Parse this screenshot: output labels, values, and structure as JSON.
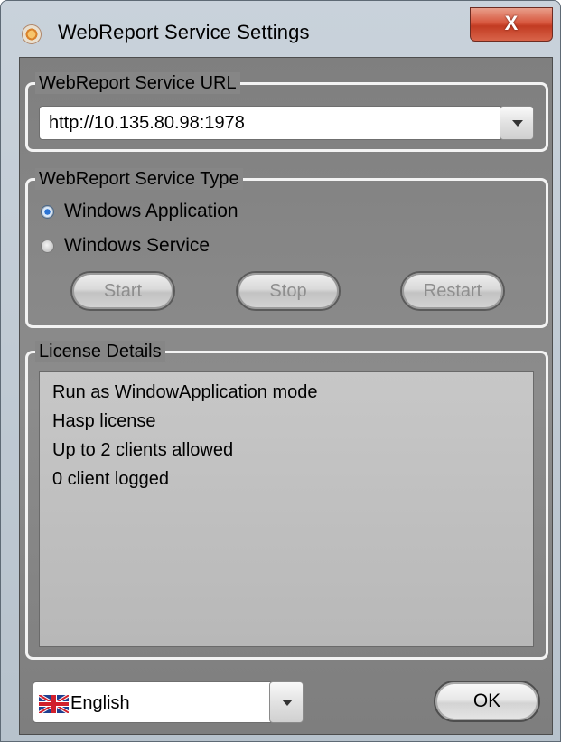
{
  "window": {
    "title": "WebReport Service Settings",
    "close_label": "X"
  },
  "url_group": {
    "legend": "WebReport Service URL",
    "selected_url": "http://10.135.80.98:1978"
  },
  "type_group": {
    "legend": "WebReport Service Type",
    "options": [
      {
        "label": "Windows Application",
        "checked": true
      },
      {
        "label": "Windows Service",
        "checked": false
      }
    ],
    "buttons": {
      "start": "Start",
      "stop": "Stop",
      "restart": "Restart"
    }
  },
  "license_group": {
    "legend": "License Details",
    "lines": [
      "Run as WindowApplication mode",
      "Hasp license",
      "Up to 2 clients allowed",
      "0 client logged"
    ]
  },
  "footer": {
    "language": "English",
    "language_flag_icon": "uk-flag-icon",
    "ok_label": "OK"
  },
  "colors": {
    "client_bg": "#868686",
    "group_border": "#f3f3f3",
    "close_red": "#c23b22",
    "radio_selected": "#2a73d4"
  }
}
